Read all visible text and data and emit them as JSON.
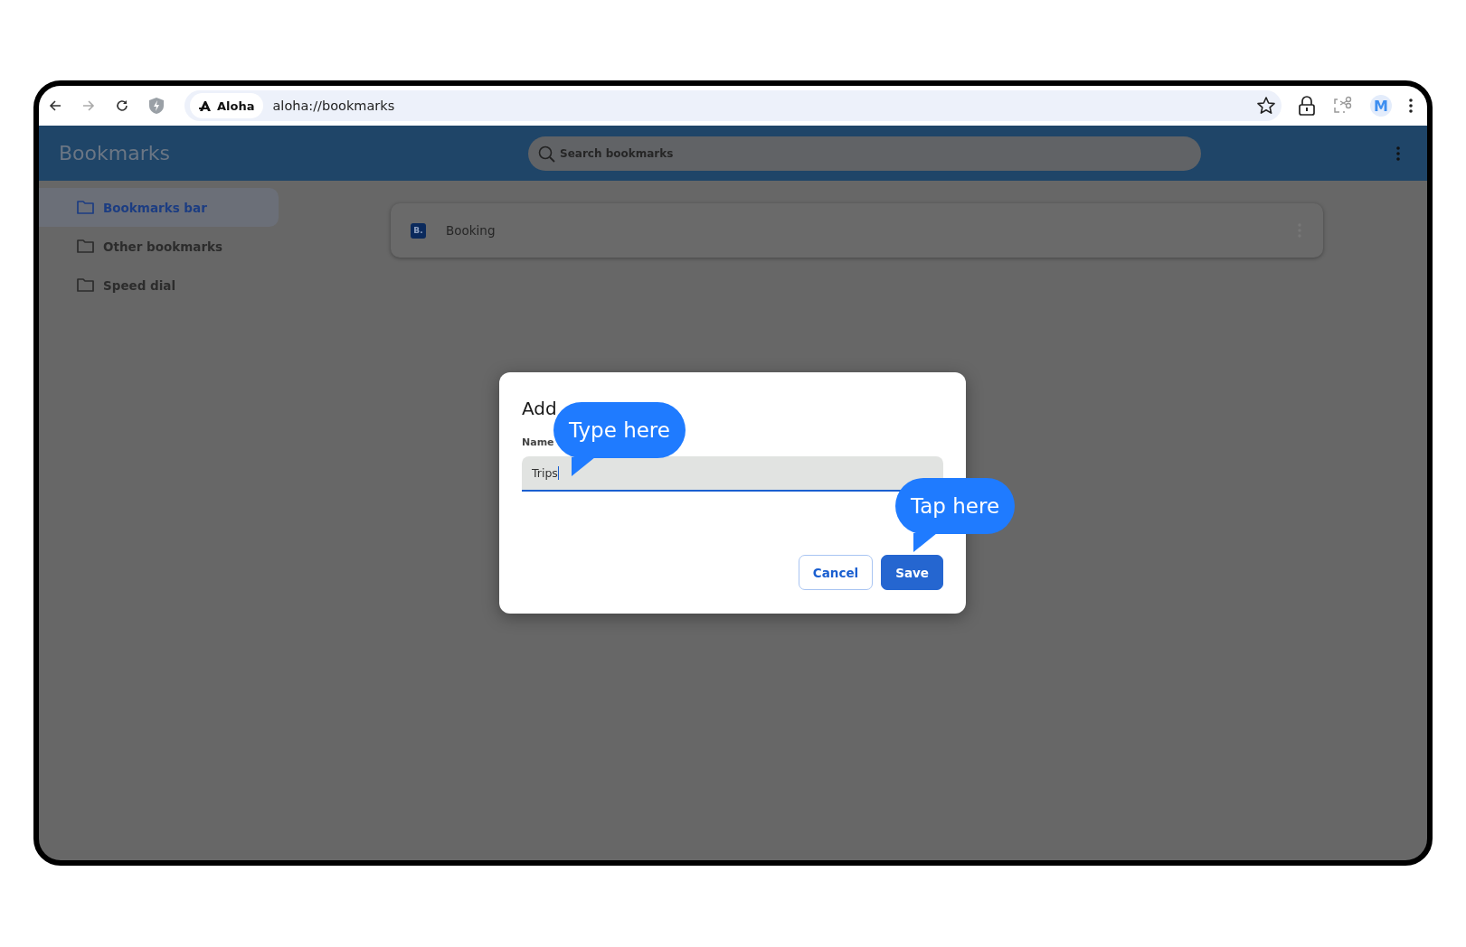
{
  "browser": {
    "forward_disabled": true,
    "site_chip": "Aloha",
    "url": "aloha://bookmarks",
    "profile_initial": "M"
  },
  "header": {
    "title": "Bookmarks",
    "search": {
      "placeholder": "Search bookmarks"
    }
  },
  "sidebar": {
    "items": [
      {
        "label": "Bookmarks bar",
        "selected": true
      },
      {
        "label": "Other bookmarks",
        "selected": false
      },
      {
        "label": "Speed dial",
        "selected": false
      }
    ]
  },
  "bookmarks": [
    {
      "favicon": "B.",
      "title": "Booking"
    }
  ],
  "dialog": {
    "title": "Add",
    "field_label": "Name",
    "field_value": "Trips",
    "buttons": [
      {
        "label": "Cancel",
        "kind": "secondary"
      },
      {
        "label": "Save",
        "kind": "primary"
      }
    ]
  },
  "callouts": [
    {
      "text": "Type here"
    },
    {
      "text": "Tap here"
    }
  ]
}
